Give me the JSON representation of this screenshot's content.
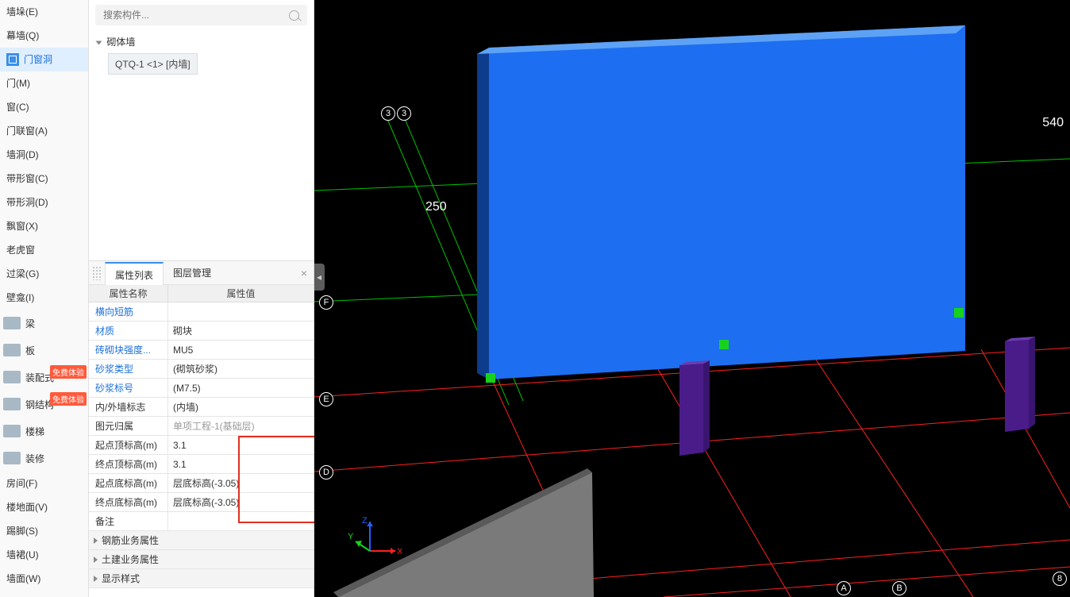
{
  "search": {
    "placeholder": "搜索构件..."
  },
  "sidebar": {
    "items_top": [
      "墙垛(E)",
      "幕墙(Q)"
    ],
    "active": "门窗洞",
    "items_win": [
      "门(M)",
      "窗(C)",
      "门联窗(A)",
      "墙洞(D)",
      "带形窗(C)",
      "带形洞(D)",
      "飘窗(X)",
      "老虎窗",
      "过梁(G)",
      "壁龛(I)"
    ],
    "cats": [
      {
        "label": "梁",
        "badge": ""
      },
      {
        "label": "板",
        "badge": ""
      },
      {
        "label": "装配式",
        "badge": "免费体验"
      },
      {
        "label": "钢结构",
        "badge": "免费体验"
      },
      {
        "label": "楼梯",
        "badge": ""
      },
      {
        "label": "装修",
        "badge": ""
      }
    ],
    "items_bottom": [
      "房间(F)",
      "楼地面(V)",
      "踢脚(S)",
      "墙裙(U)",
      "墙面(W)"
    ]
  },
  "tree": {
    "root": "砌体墙",
    "child": "QTQ-1 <1> [内墙]"
  },
  "tabs": {
    "a": "属性列表",
    "b": "图层管理"
  },
  "grid": {
    "name_header": "属性名称",
    "val_header": "属性值",
    "rows": [
      {
        "n": "横向短筋",
        "v": "",
        "blue": true
      },
      {
        "n": "材质",
        "v": "砌块",
        "blue": true
      },
      {
        "n": "砖砌块强度...",
        "v": "MU5",
        "blue": true
      },
      {
        "n": "砂浆类型",
        "v": "(砌筑砂浆)",
        "blue": true
      },
      {
        "n": "砂浆标号",
        "v": "(M7.5)",
        "blue": true
      },
      {
        "n": "内/外墙标志",
        "v": "(内墙)",
        "blue": false
      },
      {
        "n": "图元归属",
        "v": "单项工程-1(基础层)",
        "blue": false,
        "gray": true
      },
      {
        "n": "起点顶标高(m)",
        "v": "3.1",
        "blue": false
      },
      {
        "n": "终点顶标高(m)",
        "v": "3.1",
        "blue": false
      },
      {
        "n": "起点底标高(m)",
        "v": "层底标高(-3.05)",
        "blue": false
      },
      {
        "n": "终点底标高(m)",
        "v": "层底标高(-3.05)",
        "blue": false
      },
      {
        "n": "备注",
        "v": "",
        "blue": false
      }
    ],
    "groups": [
      "钢筋业务属性",
      "土建业务属性",
      "显示样式"
    ]
  },
  "viewport": {
    "dim1": "250",
    "dim2": "540",
    "axis_letters": [
      "F",
      "E",
      "D"
    ],
    "axis_nums_top": [
      "3",
      "3"
    ],
    "axis_nums_bottom": [
      "A",
      "B",
      "8"
    ],
    "ucs": {
      "x": "X",
      "y": "Y",
      "z": "Z"
    }
  },
  "colors": {
    "grid_green": "#00c200",
    "grid_red": "#ff2020",
    "wall_blue": "#1d6ef0",
    "wall_blue_dark": "#0d3c8c",
    "column": "#5a1c9e",
    "slab": "#707070",
    "square": "#17d21c"
  }
}
